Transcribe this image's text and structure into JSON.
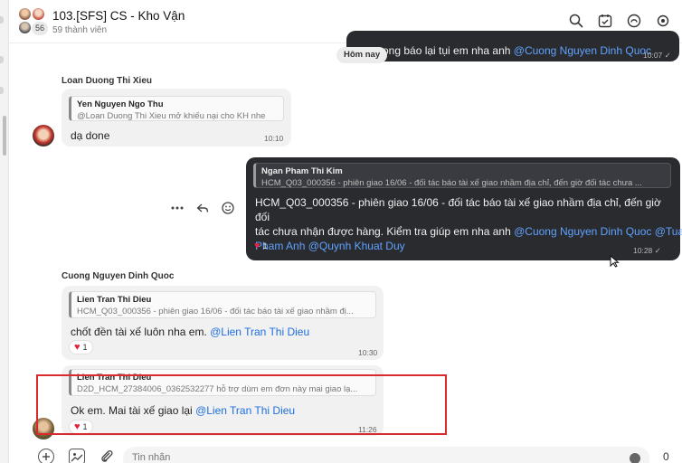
{
  "header": {
    "title": "103.[SFS] CS - Kho Vận",
    "subtitle": "59 thành viên",
    "member_badge": "56"
  },
  "date_divider": "Hôm nay",
  "messages": [
    {
      "id": "m1",
      "text_prefix": "xong báo lại tụi em nha anh ",
      "mention": "@Cuong Nguyen Dinh Quoc",
      "time": "10:07"
    },
    {
      "id": "m2",
      "sender": "Loan Duong Thi Xieu",
      "quote_name": "Yen Nguyen Ngo Thu",
      "quote_text": "@Loan Duong Thi Xieu mở khiếu nại cho KH nhe",
      "text": "dạ done",
      "time": "10:10"
    },
    {
      "id": "m3",
      "quote_name": "Ngan Pham Thi Kim",
      "quote_text": "HCM_Q03_000356 - phiên giao 16/06 - đối tác báo tài xế giao nhầm địa chỉ, đến giờ đối tác chưa ...",
      "text_line1": "HCM_Q03_000356 - phiên giao 16/06 - đối tác báo tài xế giao nhầm địa chỉ, đến giờ đối",
      "text_line2_prefix": "tác chưa nhận được hàng. Kiểm tra giúp em nha anh ",
      "mention1": "@Cuong Nguyen Dinh Quoc",
      "mention2a": "@Tuan",
      "mention2b": "Pham Anh",
      "mention3": "@Quynh Khuat Duy",
      "reaction_count": "1",
      "time": "10:28"
    },
    {
      "id": "m4",
      "sender": "Cuong Nguyen Dinh Quoc",
      "quote_name": "Lien Tran Thi Dieu",
      "quote_text": "HCM_Q03_000356 - phiên giao 16/06 - đối tác báo tài xế giao nhầm đị...",
      "text_prefix": "chốt đền tài xế luôn nha em. ",
      "mention": "@Lien Tran Thi Dieu",
      "reaction_count": "1",
      "time": "10:30"
    },
    {
      "id": "m5",
      "quote_name": "Lien Tran Thi Dieu",
      "quote_text": "D2D_HCM_27384006_0362532277 hỗ trợ dùm em đơn này mai giao lạ...",
      "text_prefix": "Ok em. Mai tài xế giao lại ",
      "mention": "@Lien Tran Thi Dieu",
      "reaction_count": "1",
      "time": "11:26"
    }
  ],
  "composer": {
    "placeholder": "Tin nhắn",
    "send_count": "0"
  },
  "colors": {
    "dark_bubble": "#2a2b2f",
    "light_bubble": "#f1f1f1",
    "mention_light": "#1f6fe0",
    "mention_dark": "#5fa2ff",
    "highlight_border": "#d92b2b",
    "heart": "#e0263a"
  },
  "icons": [
    "search-icon",
    "calendar-icon",
    "link-icon",
    "settings-icon",
    "more-icon",
    "reply-icon",
    "emoji-icon",
    "add-icon",
    "image-icon",
    "attach-icon",
    "heart-icon"
  ]
}
